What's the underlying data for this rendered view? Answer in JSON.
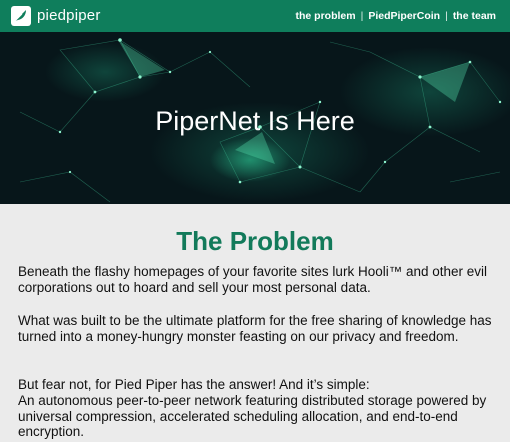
{
  "brand": {
    "name": "piedpiper"
  },
  "nav": {
    "links": [
      "the problem",
      "PiedPiperCoin",
      "the team"
    ],
    "separator": "|"
  },
  "hero": {
    "title": "PiperNet Is Here"
  },
  "section": {
    "title": "The Problem",
    "paragraph_1": "Beneath the flashy homepages of your favorite sites lurk Hooli™ and other evil corporations out to hoard and sell your most personal data.",
    "paragraph_2": "What was built to be the ultimate platform for the free sharing of knowledge has turned into a money-hungry monster feasting on our privacy and freedom.",
    "paragraph_3_line_1": "But fear not, for Pied Piper has the answer! And it’s simple:",
    "paragraph_3_line_2": "An autonomous peer-to-peer network featuring distributed storage powered by universal compression, accelerated scheduling allocation, and end-to-end encryption."
  },
  "colors": {
    "brand_green": "#0f7e5c",
    "heading_green": "#127a5a",
    "hero_background": "#07161a",
    "page_background": "#ebebeb"
  }
}
